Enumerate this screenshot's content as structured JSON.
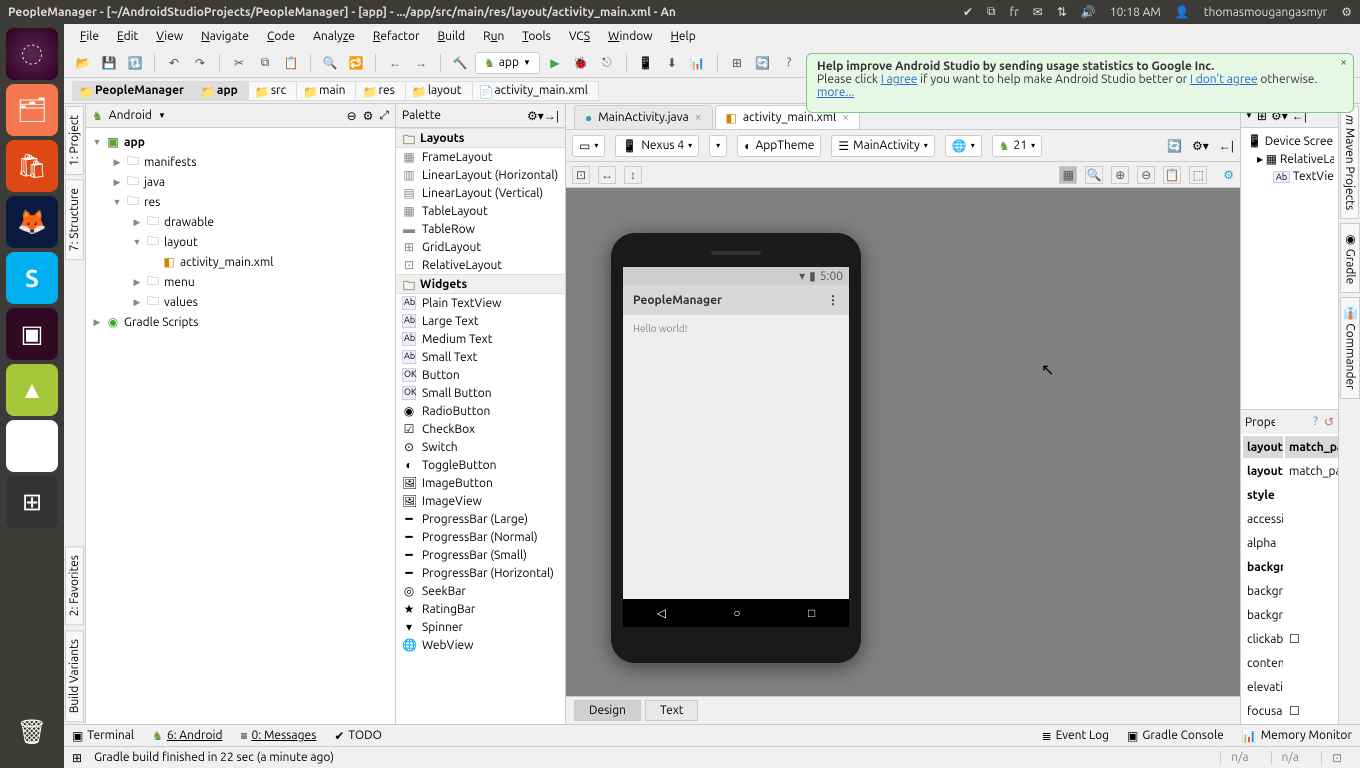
{
  "topPanel": {
    "title": "PeopleManager - [~/AndroidStudioProjects/PeopleManager] - [app] - .../app/src/main/res/layout/activity_main.xml - An",
    "keyboard": "fr",
    "time": "10:18 AM",
    "user": "thomasmougangasmyr"
  },
  "menubar": [
    "File",
    "Edit",
    "View",
    "Navigate",
    "Code",
    "Analyze",
    "Refactor",
    "Build",
    "Run",
    "Tools",
    "VCS",
    "Window",
    "Help"
  ],
  "appSelector": "app",
  "tip": {
    "title": "Help improve Android Studio by sending usage statistics to Google Inc.",
    "pre": "Please click ",
    "agree": "I agree",
    "mid": " if you want to help make Android Studio better or ",
    "dont": "I don't agree",
    "post": " otherwise. ",
    "more": "more..."
  },
  "breadcrumb": [
    "PeopleManager",
    "app",
    "src",
    "main",
    "res",
    "layout",
    "activity_main.xml"
  ],
  "projectHead": "Android",
  "tree": {
    "app": "app",
    "manifests": "manifests",
    "java": "java",
    "res": "res",
    "drawable": "drawable",
    "layout": "layout",
    "activity": "activity_main.xml",
    "menu": "menu",
    "values": "values",
    "gradle": "Gradle Scripts"
  },
  "palette": {
    "title": "Palette",
    "groups": {
      "layouts": "Layouts",
      "widgets": "Widgets"
    },
    "layouts": [
      "FrameLayout",
      "LinearLayout (Horizontal)",
      "LinearLayout (Vertical)",
      "TableLayout",
      "TableRow",
      "GridLayout",
      "RelativeLayout"
    ],
    "widgets": [
      "Plain TextView",
      "Large Text",
      "Medium Text",
      "Small Text",
      "Button",
      "Small Button",
      "RadioButton",
      "CheckBox",
      "Switch",
      "ToggleButton",
      "ImageButton",
      "ImageView",
      "ProgressBar (Large)",
      "ProgressBar (Normal)",
      "ProgressBar (Small)",
      "ProgressBar (Horizontal)",
      "SeekBar",
      "RatingBar",
      "Spinner",
      "WebView"
    ]
  },
  "tabs": {
    "t1": "MainActivity.java",
    "t2": "activity_main.xml"
  },
  "designToolbar": {
    "device": "Nexus 4",
    "theme": "AppTheme",
    "activity": "MainActivity",
    "api": "21"
  },
  "preview": {
    "time": "5:00",
    "appTitle": "PeopleManager",
    "hello": "Hello world!"
  },
  "editorFooter": {
    "design": "Design",
    "text": "Text"
  },
  "componentTree": {
    "head": "Device Screen",
    "rel": "RelativeLayout",
    "txt": "TextView"
  },
  "propsHead": "Properties",
  "props": [
    {
      "k": "layout:width",
      "v": "match_parent",
      "head": true
    },
    {
      "k": "layout:height",
      "v": "match_parent",
      "bold": true
    },
    {
      "k": "style",
      "v": "",
      "bold": true
    },
    {
      "k": "accessibility",
      "v": ""
    },
    {
      "k": "alpha",
      "v": ""
    },
    {
      "k": "background",
      "v": "",
      "bold": true
    },
    {
      "k": "backgroundTint",
      "v": ""
    },
    {
      "k": "backgroundTintMode",
      "v": ""
    },
    {
      "k": "clickable",
      "v": "☐"
    },
    {
      "k": "contentDescription",
      "v": ""
    },
    {
      "k": "elevation",
      "v": ""
    },
    {
      "k": "focusable",
      "v": "☐"
    }
  ],
  "bottomTools": {
    "terminal": "Terminal",
    "android": "6: Android",
    "messages": "0: Messages",
    "todo": "TODO",
    "eventlog": "Event Log",
    "gradlec": "Gradle Console",
    "memory": "Memory Monitor"
  },
  "status": {
    "msg": "Gradle build finished in 22 sec (a minute ago)",
    "na": "n/a"
  }
}
